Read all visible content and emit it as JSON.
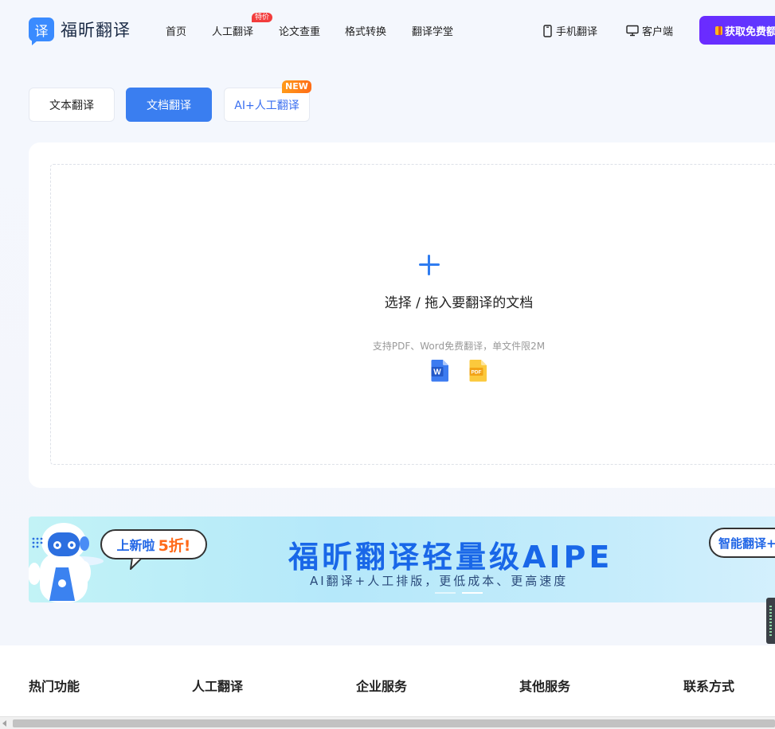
{
  "header": {
    "logo_glyph": "译",
    "brand": "福昕翻译",
    "nav": [
      {
        "label": "首页"
      },
      {
        "label": "人工翻译",
        "badge": "特价"
      },
      {
        "label": "论文查重"
      },
      {
        "label": "格式转换"
      },
      {
        "label": "翻译学堂"
      }
    ],
    "mobile_label": "手机翻译",
    "client_label": "客户端",
    "cta_label": "获取免费额度",
    "icons": {
      "mobile": "phone-icon",
      "client": "monitor-icon",
      "cta": "gift-icon"
    }
  },
  "tabs": [
    {
      "label": "文本翻译",
      "active": false
    },
    {
      "label": "文档翻译",
      "active": true
    },
    {
      "label": "AI+人工翻译",
      "active": false,
      "badge": "NEW"
    }
  ],
  "upload": {
    "title": "选择 / 拖入要翻译的文档",
    "hint": "支持PDF、Word免费翻译，单文件限2M",
    "file_types": [
      "W",
      "PDF"
    ]
  },
  "banner": {
    "bubble_left_main": "上新啦",
    "bubble_left_accent": "5折!",
    "title": "福昕翻译轻量级AIPE",
    "subtitle": "AI翻译+人工排版，更低成本、更高速度",
    "bubble_right": "智能翻译+"
  },
  "footer": {
    "columns": [
      "热门功能",
      "人工翻译",
      "企业服务",
      "其他服务",
      "联系方式"
    ]
  },
  "colors": {
    "primary": "#3a7ef0",
    "cta": "#6b2bff",
    "badge_red": "#f23c3c",
    "badge_orange": "#ff7a17",
    "banner_title": "#1967e8"
  }
}
